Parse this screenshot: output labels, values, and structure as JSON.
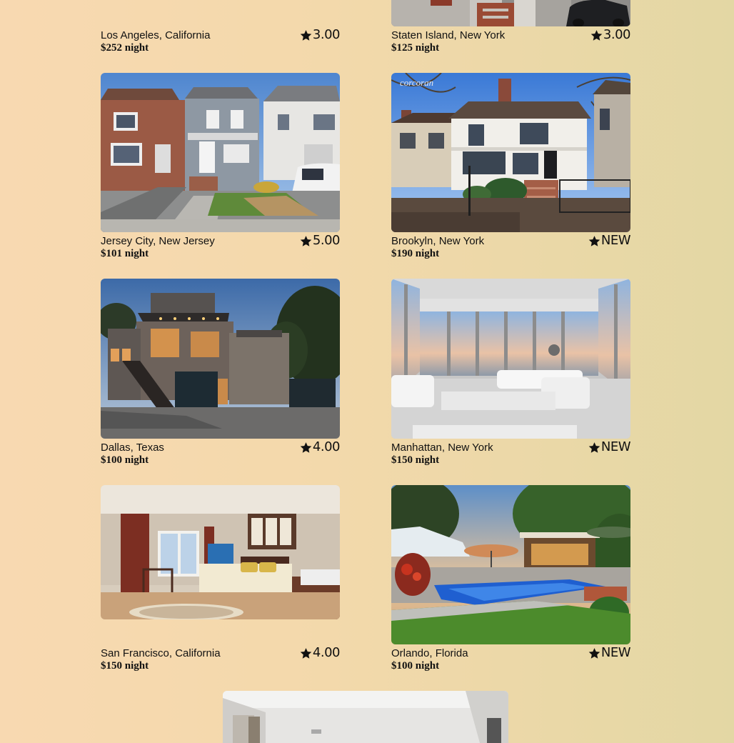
{
  "listings": [
    {
      "location": "Los Angeles, California",
      "price": "$252 night",
      "rating": "3.00",
      "image": "partial-exterior-cropped"
    },
    {
      "location": "Staten Island, New York",
      "price": "$125 night",
      "rating": "3.00",
      "image": "street-porch-car"
    },
    {
      "location": "Jersey City, New Jersey",
      "price": "$101 night",
      "rating": "5.00",
      "image": "row-houses-suv"
    },
    {
      "location": "Brookyln, New York",
      "price": "$190 night",
      "rating": "NEW",
      "image": "white-colonial-house"
    },
    {
      "location": "Dallas, Texas",
      "price": "$100 night",
      "rating": "4.00",
      "image": "modern-brick-house-dusk"
    },
    {
      "location": "Manhattan, New York",
      "price": "$150 night",
      "rating": "NEW",
      "image": "penthouse-living-room"
    },
    {
      "location": "San Francisco, California",
      "price": "$150 night",
      "rating": "4.00",
      "image": "bedroom-interior"
    },
    {
      "location": "Orlando, Florida",
      "price": "$100 night",
      "rating": "NEW",
      "image": "pool-backyard"
    },
    {
      "image": "partial-interior-cropped"
    }
  ],
  "icons": {
    "rating": "star-icon"
  }
}
